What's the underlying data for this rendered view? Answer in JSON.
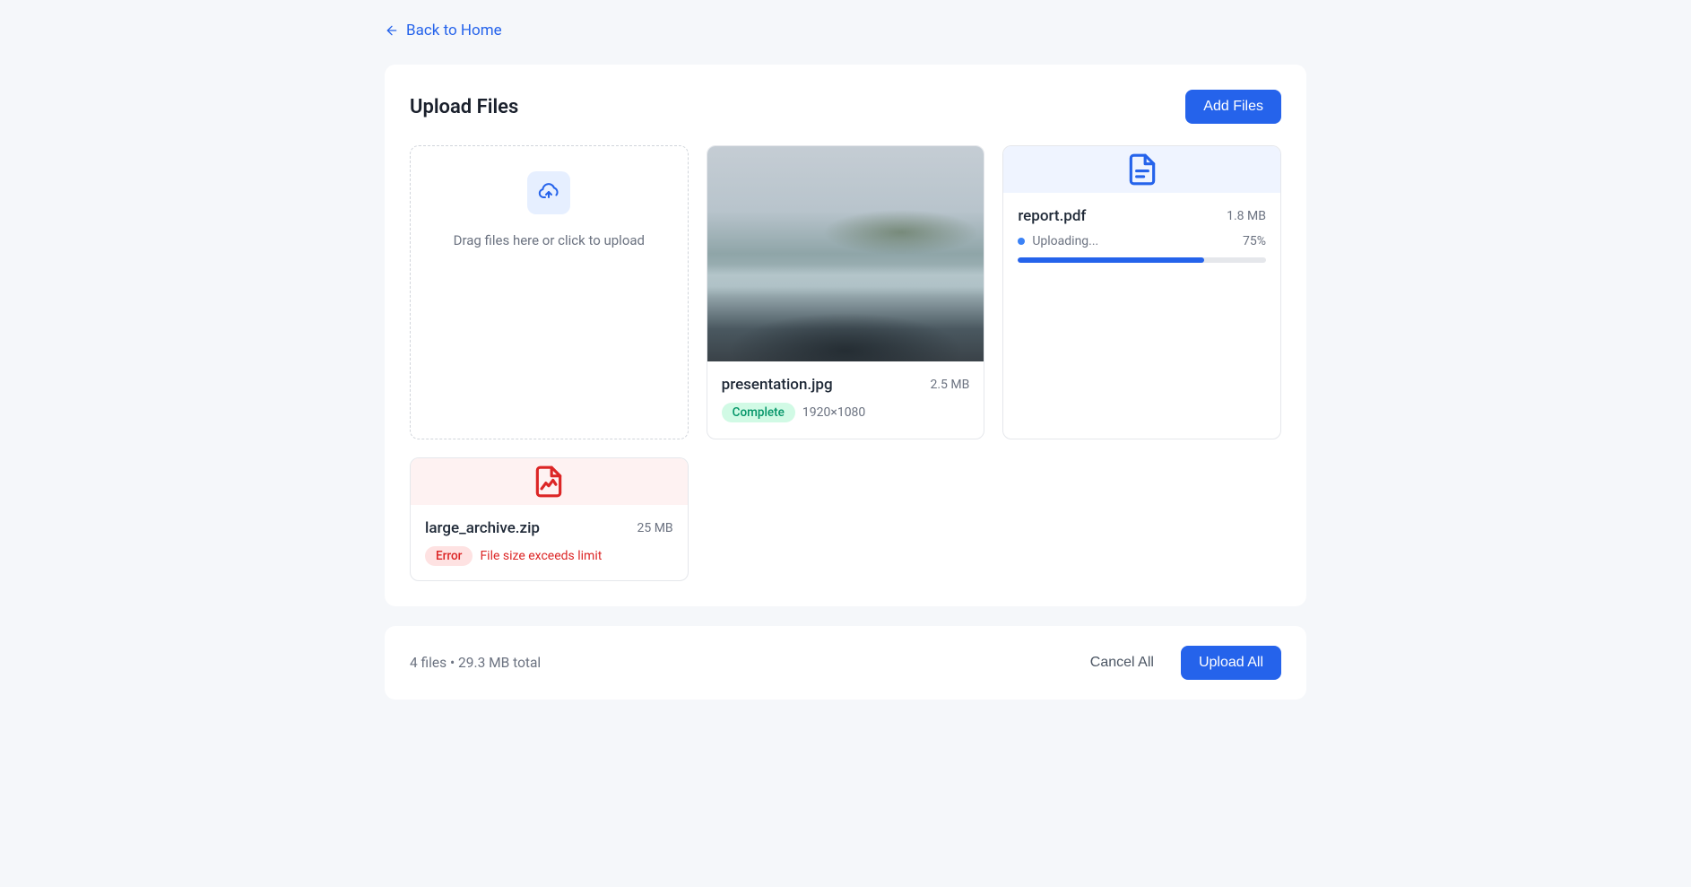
{
  "nav": {
    "back_label": "Back to Home"
  },
  "header": {
    "title": "Upload Files",
    "add_button": "Add Files"
  },
  "dropzone": {
    "text": "Drag files here or click to upload"
  },
  "files": [
    {
      "name": "presentation.jpg",
      "size": "2.5 MB",
      "status": "complete",
      "status_label": "Complete",
      "meta": "1920×1080"
    },
    {
      "name": "report.pdf",
      "size": "1.8 MB",
      "status": "uploading",
      "status_label": "Uploading...",
      "progress_pct": "75%",
      "progress_value": 75
    },
    {
      "name": "large_archive.zip",
      "size": "25 MB",
      "status": "error",
      "status_label": "Error",
      "error_msg": "File size exceeds limit"
    }
  ],
  "footer": {
    "summary": "4 files • 29.3 MB total",
    "cancel_label": "Cancel All",
    "upload_label": "Upload All"
  }
}
